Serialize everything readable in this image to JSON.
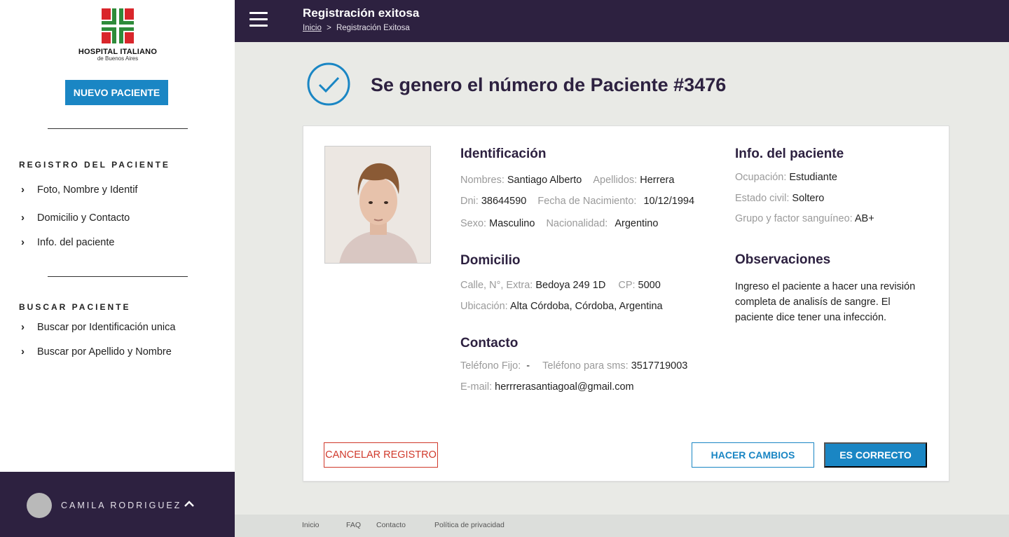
{
  "sidebar": {
    "logo_title": "HOSPITAL ITALIANO",
    "logo_subtitle": "de Buenos Aires",
    "new_patient_label": "NUEVO PACIENTE",
    "register_section_title": "REGISTRO DEL PACIENTE",
    "register_items": [
      {
        "label": "Foto, Nombre y Identif"
      },
      {
        "label": "Domicilio y Contacto"
      },
      {
        "label": "Info. del paciente"
      }
    ],
    "search_section_title": "BUSCAR PACIENTE",
    "search_items": [
      {
        "label": "Buscar por Identificación unica"
      },
      {
        "label": "Buscar por Apellido y Nombre"
      }
    ],
    "user_name": "CAMILA RODRIGUEZ"
  },
  "header": {
    "title": "Registración exitosa",
    "breadcrumb_home": "Inicio",
    "breadcrumb_sep": ">",
    "breadcrumb_current": "Registración Exitosa"
  },
  "success_message": "Se genero el número de Paciente #3476",
  "card": {
    "identificacion": {
      "title": "Identificación",
      "nombres_label": "Nombres:",
      "nombres": "Santiago Alberto",
      "apellidos_label": "Apellidos:",
      "apellidos": "Herrera",
      "dni_label": "Dni:",
      "dni": "38644590",
      "fecha_label": "Fecha de Nacimiento:",
      "fecha": "10/12/1994",
      "sexo_label": "Sexo:",
      "sexo": "Masculino",
      "nacionalidad_label": "Nacionalidad:",
      "nacionalidad": "Argentino"
    },
    "domicilio": {
      "title": "Domicilio",
      "calle_label": "Calle, N°, Extra:",
      "calle": "Bedoya 249 1D",
      "cp_label": "CP:",
      "cp": "5000",
      "ubicacion_label": "Ubicación:",
      "ubicacion": "Alta Córdoba, Córdoba, Argentina"
    },
    "contacto": {
      "title": "Contacto",
      "tel_fijo_label": "Teléfono Fijo:",
      "tel_fijo": "-",
      "tel_sms_label": "Teléfono para sms:",
      "tel_sms": "3517719003",
      "email_label": "E-mail:",
      "email": "herrrerasantiagoal@gmail.com"
    },
    "info": {
      "title": "Info. del paciente",
      "ocupacion_label": "Ocupación:",
      "ocupacion": "Estudiante",
      "estado_label": "Estado civil:",
      "estado": "Soltero",
      "grupo_label": "Grupo y factor sanguíneo:",
      "grupo": "AB+"
    },
    "observaciones": {
      "title": "Observaciones",
      "text": "Ingreso el paciente a hacer una revisión completa de analisís de sangre. El paciente dice tener una infección."
    },
    "buttons": {
      "cancel": "CANCELAR REGISTRO",
      "changes": "HACER CAMBIOS",
      "confirm": "ES CORRECTO"
    }
  },
  "footer": {
    "links": [
      "Inicio",
      "FAQ",
      "Contacto",
      "Política de privacidad"
    ]
  },
  "colors": {
    "primary": "#1a86c4",
    "dark": "#2d2140",
    "danger": "#d0392b",
    "logo_green": "#2e8b3a",
    "logo_red": "#d9262b"
  },
  "icons": [
    "hamburger-icon",
    "check-circle-icon",
    "chevron-right-icon",
    "chevron-up-icon",
    "hospital-cross-logo"
  ]
}
